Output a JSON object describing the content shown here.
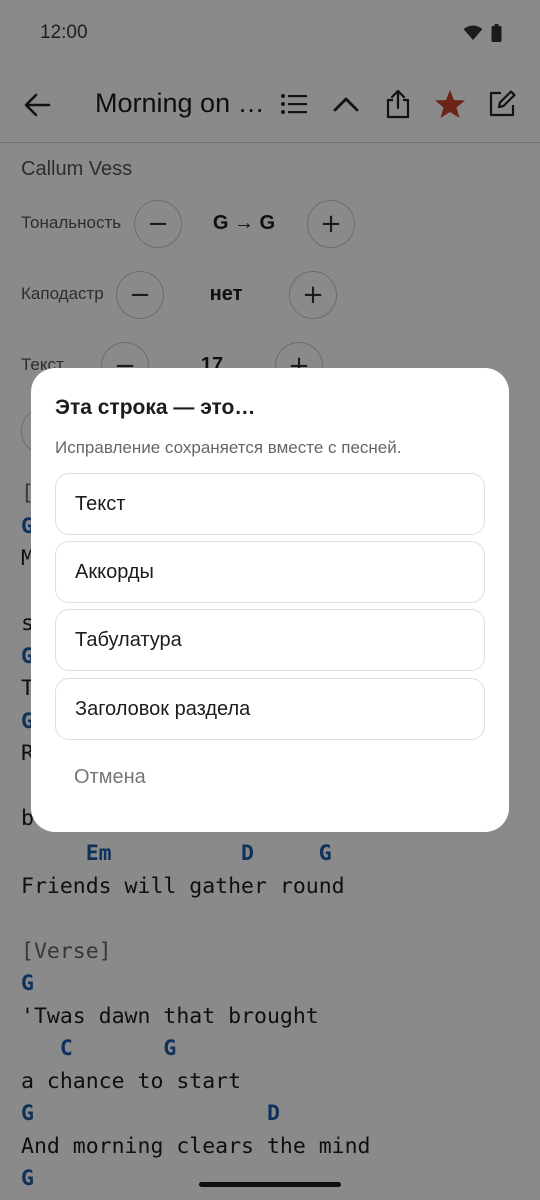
{
  "status": {
    "time": "12:00"
  },
  "toolbar": {
    "title": "Morning on the Hill",
    "accent_star": "#c9452f",
    "icons": [
      "back-arrow-icon",
      "list-icon",
      "chevron-up-icon",
      "share-icon",
      "star-icon",
      "edit-icon"
    ]
  },
  "song": {
    "artist": "Callum Vess",
    "key": {
      "label": "Тональность",
      "value": "G → G"
    },
    "capo": {
      "label": "Каподастр",
      "value": "нет"
    },
    "text_size": {
      "label": "Текст",
      "value": "17"
    }
  },
  "lyrics": {
    "lines": [
      {
        "kind": "chord",
        "text": "     Em          D     G"
      },
      {
        "kind": "lyric",
        "text": "Friends will gather round"
      },
      {
        "kind": "blank",
        "text": ""
      },
      {
        "kind": "section",
        "text": "[Verse]"
      },
      {
        "kind": "chord",
        "text": "G"
      },
      {
        "kind": "lyric",
        "text": "'Twas dawn that brought"
      },
      {
        "kind": "chord",
        "text": "   C       G"
      },
      {
        "kind": "lyric",
        "text": "a chance to start"
      },
      {
        "kind": "chord",
        "text": "G                  D"
      },
      {
        "kind": "lyric",
        "text": "And morning clears the mind"
      },
      {
        "kind": "chord",
        "text": "G"
      }
    ],
    "partial_left": [
      {
        "kind": "section",
        "text": "["
      },
      {
        "kind": "chord",
        "text": "G"
      },
      {
        "kind": "lyric",
        "text": "M"
      },
      {
        "kind": "blank",
        "text": ""
      },
      {
        "kind": "lyric",
        "text": "s"
      },
      {
        "kind": "chord",
        "text": "G"
      },
      {
        "kind": "lyric",
        "text": "T"
      },
      {
        "kind": "chord",
        "text": "G"
      },
      {
        "kind": "lyric",
        "text": "R"
      },
      {
        "kind": "blank",
        "text": ""
      },
      {
        "kind": "lyric",
        "text": "b"
      }
    ]
  },
  "dialog": {
    "title": "Эта строка — это…",
    "subtitle": "Исправление сохраняется вместе с песней.",
    "options": [
      "Текст",
      "Аккорды",
      "Табулатура",
      "Заголовок раздела"
    ],
    "cancel": "Отмена"
  }
}
